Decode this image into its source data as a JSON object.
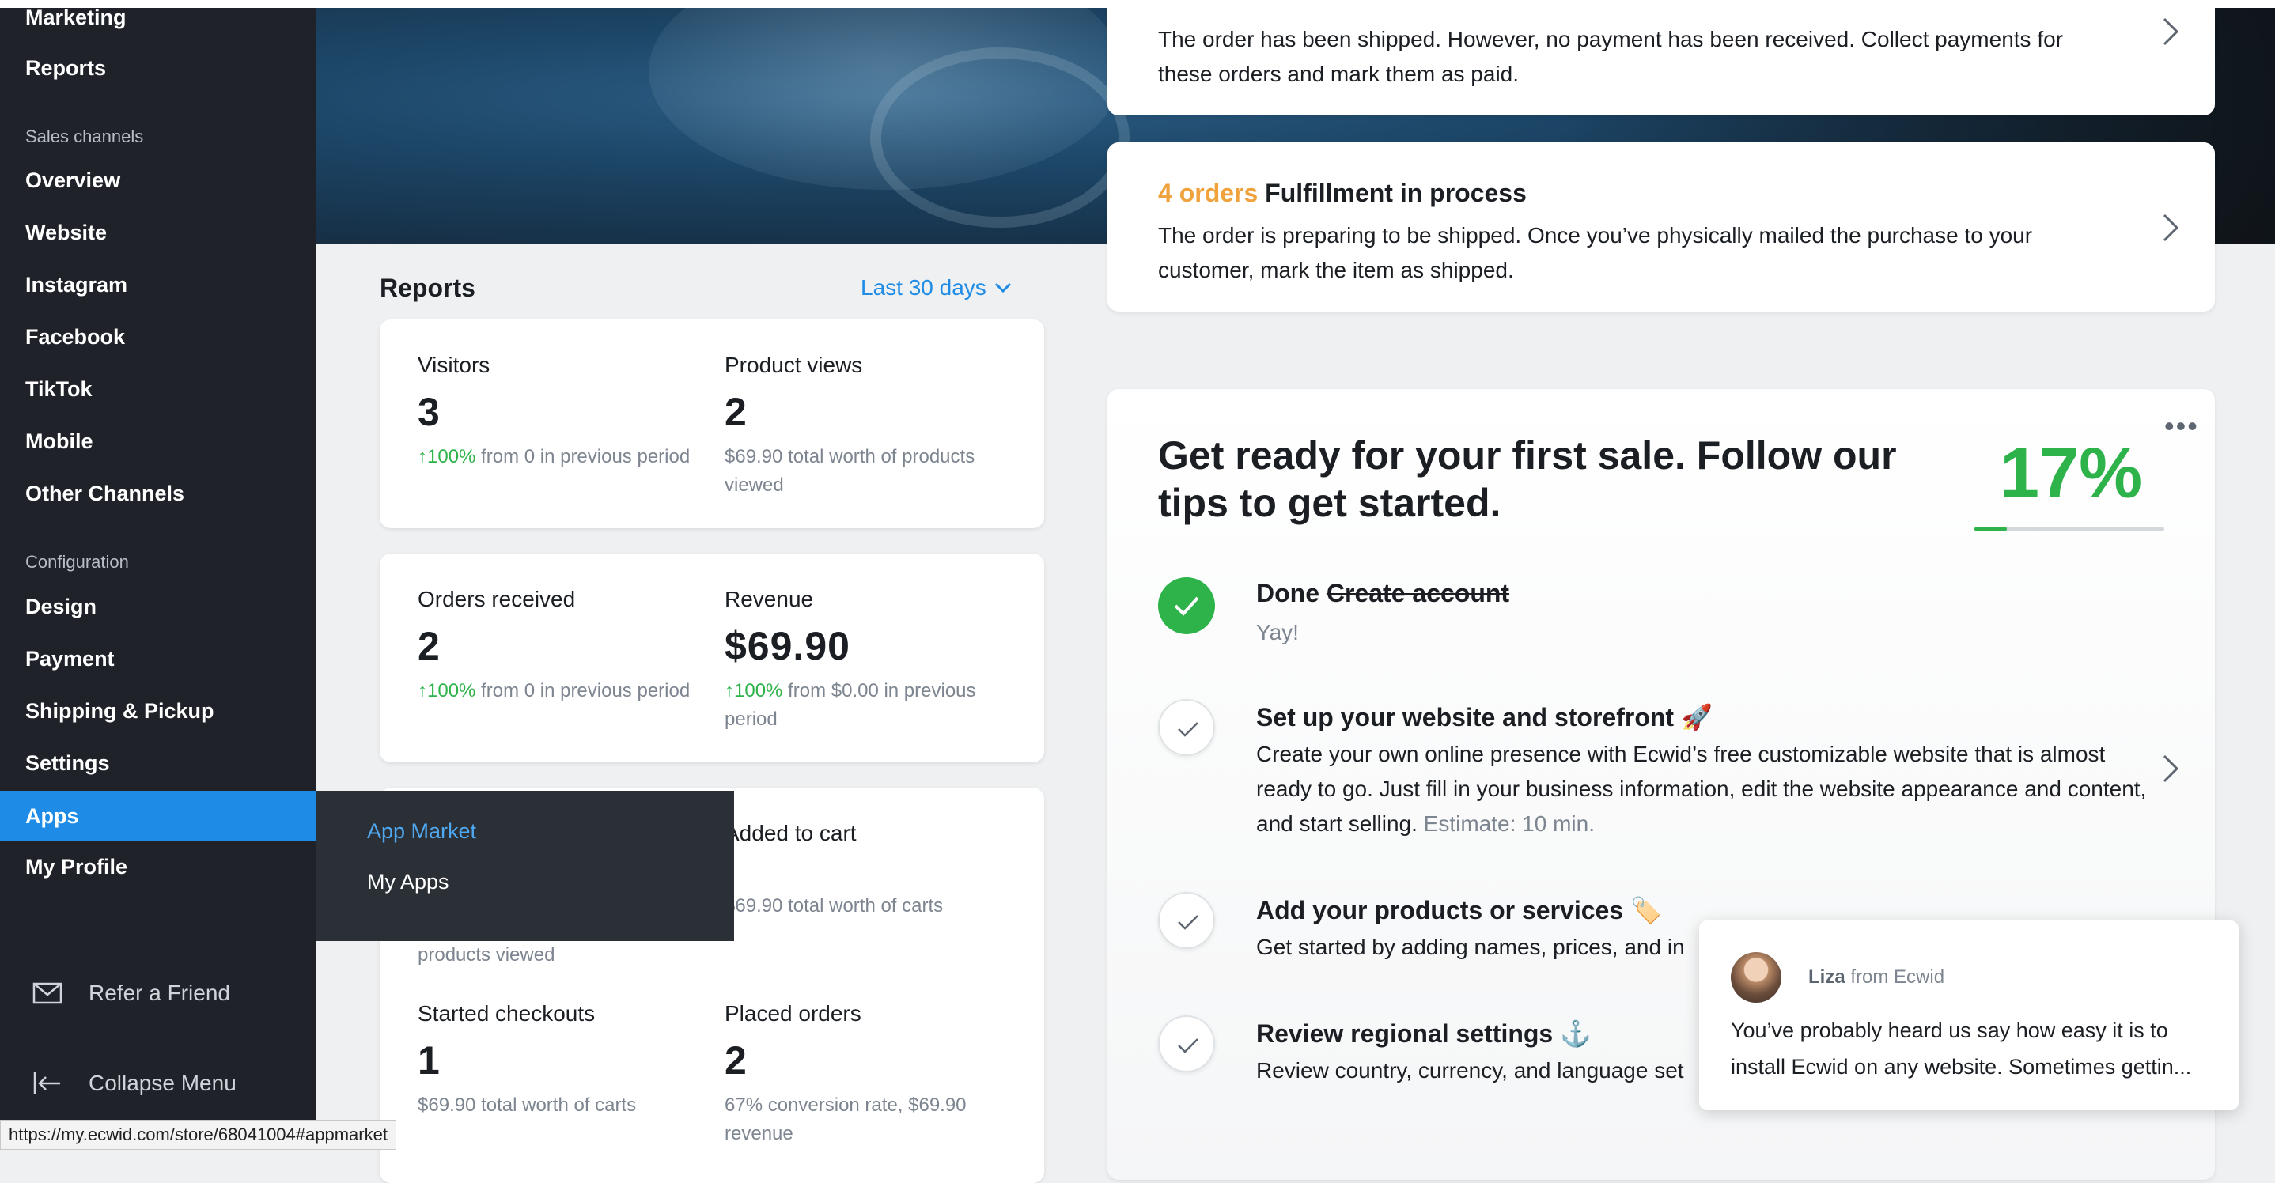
{
  "sidebar": {
    "items_top": [
      "Marketing",
      "Reports"
    ],
    "section_sales": "Sales channels",
    "sales_items": [
      "Overview",
      "Website",
      "Instagram",
      "Facebook",
      "TikTok",
      "Mobile",
      "Other Channels"
    ],
    "section_config": "Configuration",
    "config_items": [
      "Design",
      "Payment",
      "Shipping & Pickup",
      "Settings",
      "Apps",
      "My Profile"
    ],
    "refer": "Refer a Friend",
    "collapse": "Collapse Menu"
  },
  "flyout": {
    "items": [
      "App Market",
      "My Apps"
    ]
  },
  "reports": {
    "title": "Reports",
    "range": "Last 30 days",
    "visitors": {
      "label": "Visitors",
      "value": "3",
      "change": "↑100%",
      "note": " from 0 in previous period"
    },
    "product_views": {
      "label": "Product views",
      "value": "2",
      "note": "$69.90 total worth of products viewed"
    },
    "orders_received": {
      "label": "Orders received",
      "value": "2",
      "change": "↑100%",
      "note": " from 0 in previous period"
    },
    "revenue": {
      "label": "Revenue",
      "value": "$69.90",
      "change": "↑100%",
      "note": " from $0.00 in previous period"
    },
    "added_to_cart": {
      "label": "Added to cart",
      "note": "$69.90 total worth of carts"
    },
    "hidden_note": "products viewed",
    "started_checkouts": {
      "label": "Started checkouts",
      "value": "1",
      "note": "$69.90 total worth of carts"
    },
    "placed_orders": {
      "label": "Placed orders",
      "value": "2",
      "note": "67% conversion rate, $69.90 revenue"
    }
  },
  "orders": {
    "unpaid_text": "The order has been shipped. However, no payment has been received. Collect payments for these orders and mark them as paid.",
    "fulfill_count": "4 orders",
    "fulfill_title": "Fulfillment in process",
    "fulfill_text": "The order is preparing to be shipped. Once you’ve physically mailed the purchase to your customer, mark the item as shipped."
  },
  "tips": {
    "title": "Get ready for your first sale. Follow our tips to get started.",
    "percent": "17%",
    "progress": 0.17,
    "tasks": [
      {
        "prefix": "Done",
        "title": "Create account",
        "desc": "Yay!"
      },
      {
        "title": "Set up your website and storefront 🚀",
        "desc": "Create your own online presence with Ecwid’s free customizable website that is almost ready to go. Just fill in your business information, edit the website appearance and content, and start selling.",
        "estimate": "Estimate: 10 min."
      },
      {
        "title": "Add your products or services 🏷️",
        "desc": "Get started by adding names, prices, and in"
      },
      {
        "title": "Review regional settings ⚓",
        "desc": "Review country, currency, and language set"
      }
    ]
  },
  "chat": {
    "name": "Liza",
    "from": "from Ecwid",
    "message": "You’ve probably heard us say how easy it is to install Ecwid on any website. Sometimes gettin..."
  },
  "status_url": "https://my.ecwid.com/store/68041004#appmarket",
  "colors": {
    "accent": "#1e8ce6",
    "green": "#2db34a",
    "orange": "#f0a23c",
    "sidebar": "#1f2329"
  }
}
